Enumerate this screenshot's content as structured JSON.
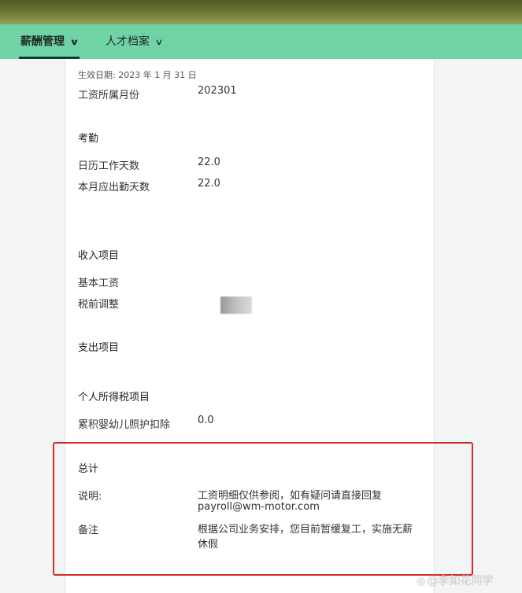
{
  "nav": {
    "items": [
      {
        "label": "薪酬管理",
        "active": true
      },
      {
        "label": "人才档案",
        "active": false
      }
    ]
  },
  "payslip": {
    "effective_date": "生效日期:  2023 年 1 月 31 日",
    "salary_month_label": "工资所属月份",
    "salary_month_value": "202301",
    "attendance_title": "考勤",
    "calendar_days_label": "日历工作天数",
    "calendar_days_value": "22.0",
    "required_days_label": "本月应出勤天数",
    "required_days_value": "22.0",
    "income_title": "收入项目",
    "base_salary_label": "基本工资",
    "pretax_adjust_label": "税前调整",
    "expense_title": "支出项目",
    "tax_title": "个人所得税项目",
    "childcare_label": "累积婴幼儿照护扣除",
    "childcare_value": "0.0",
    "total_title": "总计",
    "note_label": "说明:",
    "note_line1": "工资明细仅供参阅，如有疑问请直接回复",
    "note_line2": "payroll@wm-motor.com",
    "remark_label": "备注",
    "remark_line1": "根据公司业务安排，您目前暂缓复工，实施无薪",
    "remark_line2": "休假"
  },
  "watermark": {
    "logo_icon": "weibo-icon",
    "text": "@李如花同学"
  },
  "colors": {
    "nav_bg": "#6fd3a6",
    "nav_underline": "#0b3b35",
    "highlight_box": "#d32b2b"
  }
}
